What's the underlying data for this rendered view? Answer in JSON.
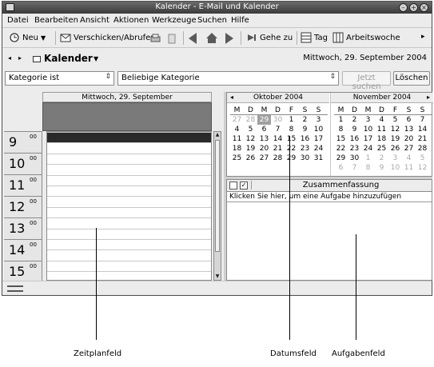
{
  "window": {
    "title": "Kalender - E-Mail und Kalender"
  },
  "menubar": [
    {
      "label": "Datei"
    },
    {
      "label": "Bearbeiten"
    },
    {
      "label": "Ansicht"
    },
    {
      "label": "Aktionen"
    },
    {
      "label": "Werkzeuge"
    },
    {
      "label": "Suchen"
    },
    {
      "label": "Hilfe"
    }
  ],
  "toolbar": {
    "new": "Neu",
    "send_receive": "Verschicken/Abrufen",
    "goto": "Gehe zu",
    "day": "Tag",
    "workweek": "Arbeitswoche"
  },
  "nav": {
    "title": "Kalender",
    "date": "Mittwoch, 29. September 2004"
  },
  "filter": {
    "category_is": "Kategorie ist",
    "any_category": "Beliebige Kategorie",
    "search_now": "Jetzt suchen",
    "clear": "Löschen"
  },
  "dayview": {
    "header": "Mittwoch, 29. September",
    "hours": [
      "9",
      "10",
      "11",
      "12",
      "13",
      "14",
      "15"
    ],
    "minutes": "00"
  },
  "calendars": [
    {
      "month": "Oktober 2004",
      "days_of_week": [
        "M",
        "D",
        "M",
        "D",
        "F",
        "S",
        "S"
      ],
      "weeks": [
        [
          "27",
          "28",
          "29",
          "30",
          "1",
          "2",
          "3"
        ],
        [
          "4",
          "5",
          "6",
          "7",
          "8",
          "9",
          "10"
        ],
        [
          "11",
          "12",
          "13",
          "14",
          "15",
          "16",
          "17"
        ],
        [
          "18",
          "19",
          "20",
          "21",
          "22",
          "23",
          "24"
        ],
        [
          "25",
          "26",
          "27",
          "28",
          "29",
          "30",
          "31"
        ]
      ]
    },
    {
      "month": "November 2004",
      "days_of_week": [
        "M",
        "D",
        "M",
        "D",
        "F",
        "S",
        "S"
      ],
      "weeks": [
        [
          "1",
          "2",
          "3",
          "4",
          "5",
          "6",
          "7"
        ],
        [
          "8",
          "9",
          "10",
          "11",
          "12",
          "13",
          "14"
        ],
        [
          "15",
          "16",
          "17",
          "18",
          "19",
          "20",
          "21"
        ],
        [
          "22",
          "23",
          "24",
          "25",
          "26",
          "27",
          "28"
        ],
        [
          "29",
          "30",
          "1",
          "2",
          "3",
          "4",
          "5"
        ],
        [
          "6",
          "7",
          "8",
          "9",
          "10",
          "11",
          "12"
        ]
      ]
    }
  ],
  "tasks": {
    "header": "Zusammenfassung",
    "add_hint": "Klicken Sie hier, um eine Aufgabe hinzuzufügen"
  },
  "callouts": {
    "schedule": "Zeitplanfeld",
    "date": "Datumsfeld",
    "tasks": "Aufgabenfeld"
  },
  "colors": {
    "titlebar": "#4a4a4a",
    "today_highlight": "#a0a0a0",
    "allday_band": "#7a7a7a"
  }
}
